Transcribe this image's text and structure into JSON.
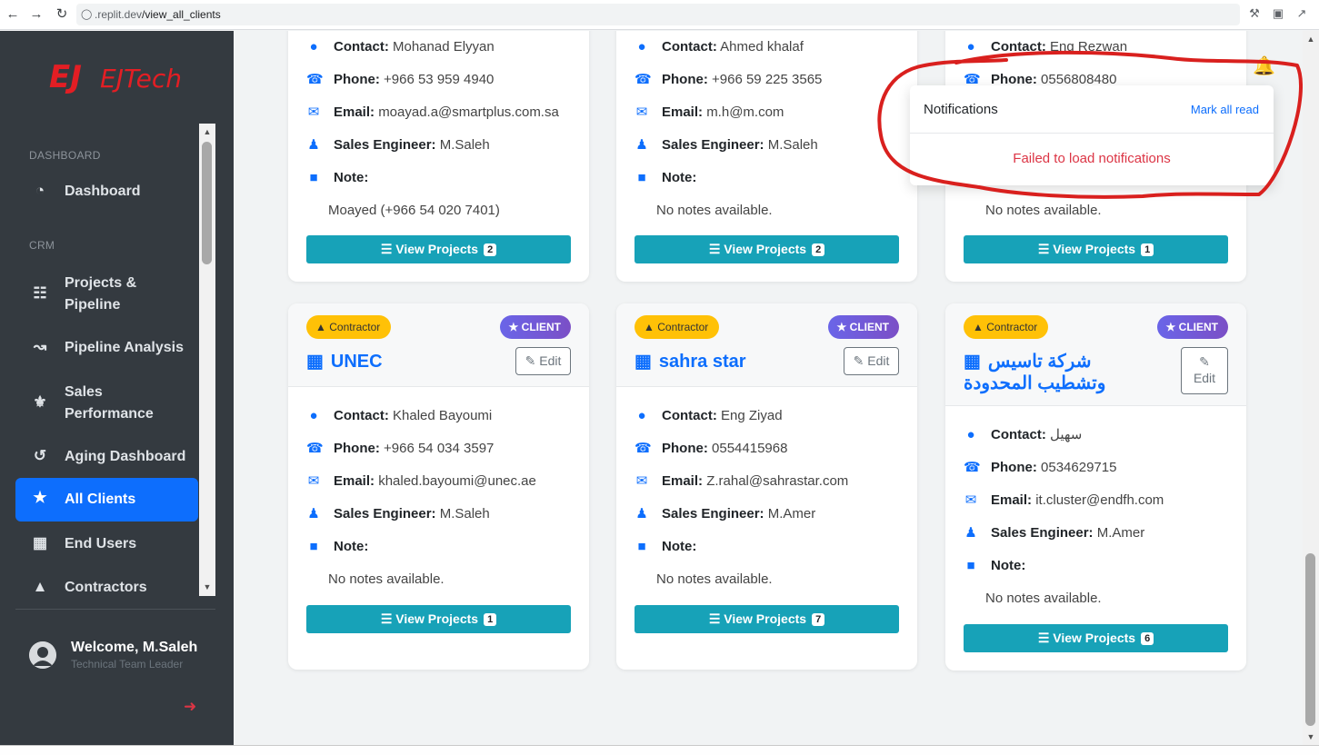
{
  "browser": {
    "url_host": ".replit.dev",
    "url_path": "/view_all_clients"
  },
  "sidebar": {
    "brand": "EJTech",
    "sections": [
      "DASHBOARD",
      "CRM"
    ],
    "items": [
      {
        "label": "Dashboard",
        "icon": "speedometer-icon"
      },
      {
        "label": "Projects & Pipeline",
        "icon": "diagram-icon"
      },
      {
        "label": "Pipeline Analysis",
        "icon": "chart-line-icon"
      },
      {
        "label": "Sales Performance",
        "icon": "trophy-icon"
      },
      {
        "label": "Aging Dashboard",
        "icon": "history-icon"
      },
      {
        "label": "All Clients",
        "icon": "star-icon",
        "active": true
      },
      {
        "label": "End Users",
        "icon": "building-icon"
      },
      {
        "label": "Contractors",
        "icon": "hard-hat-icon"
      }
    ],
    "user": {
      "welcome": "Welcome, M.Saleh",
      "role": "Technical Team Leader"
    }
  },
  "labels": {
    "contact": "Contact:",
    "phone": "Phone:",
    "email": "Email:",
    "sales_engineer": "Sales Engineer:",
    "note": "Note:",
    "view_projects": "View Projects",
    "edit": "Edit",
    "badge_contractor": "Contractor",
    "badge_client": "CLIENT"
  },
  "cards_top": [
    {
      "contact": "Mohanad Elyyan",
      "phone": "+966 53 959 4940",
      "email": "moayad.a@smartplus.com.sa",
      "engineer": "M.Saleh",
      "note": "Moayed (+966 54 020 7401)",
      "projects": "2"
    },
    {
      "contact": "Ahmed khalaf",
      "phone": "+966 59 225 3565",
      "email": "m.h@m.com",
      "engineer": "M.Saleh",
      "note": "No notes available.",
      "projects": "2"
    },
    {
      "contact": "Eng Rezwan",
      "phone": "0556808480",
      "email": "",
      "engineer": "",
      "note": "No notes available.",
      "projects": "1"
    }
  ],
  "cards_bottom": [
    {
      "name": "UNEC",
      "contact": "Khaled Bayoumi",
      "phone": "+966 54 034 3597",
      "email": "khaled.bayoumi@unec.ae",
      "engineer": "M.Saleh",
      "note": "No notes available.",
      "projects": "1"
    },
    {
      "name": "sahra star",
      "contact": "Eng Ziyad",
      "phone": "0554415968",
      "email": "Z.rahal@sahrastar.com",
      "engineer": "M.Amer",
      "note": "No notes available.",
      "projects": "7"
    },
    {
      "name": "شركة تاسيس وتشطيب المحدودة",
      "contact": "سهيل",
      "phone": "0534629715",
      "email": "it.cluster@endfh.com",
      "engineer": "M.Amer",
      "note": "No notes available.",
      "projects": "6"
    }
  ],
  "notifications": {
    "title": "Notifications",
    "mark_all": "Mark all read",
    "error": "Failed to load notifications"
  },
  "colors": {
    "primary": "#0d6efd",
    "info_button": "#17a2b8",
    "sidebar": "#343a40",
    "contractor_badge": "#ffc107",
    "error": "#dc3545",
    "annotation": "#d9201e"
  }
}
